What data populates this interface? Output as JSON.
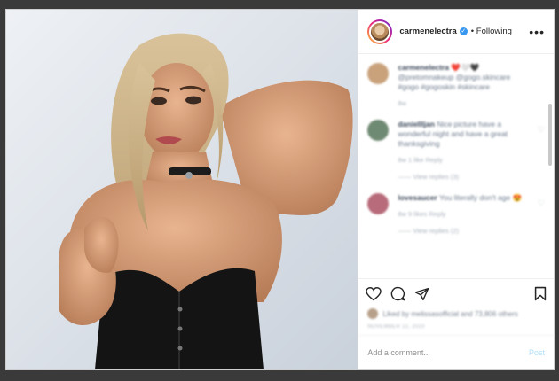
{
  "post": {
    "username": "carmenelectra",
    "follow_state": "• Following",
    "more_label": "•••"
  },
  "comments": [
    {
      "author": "carmenelectra",
      "text": "❤️🤍🖤 @pretomnakeup @gogo.skincare #gogo #gogoskin #skincare",
      "meta": "8w",
      "avatar_color": "#c9a27c"
    },
    {
      "author": "daniellljan",
      "text": "Nice picture have a wonderful night and have a great thanksgiving",
      "meta": "8w   1 like   Reply",
      "replies": "View replies (3)",
      "avatar_color": "#6f8a73"
    },
    {
      "author": "lovesaucer",
      "text": "You literally don't age 😍",
      "meta": "8w   9 likes   Reply",
      "replies": "View replies (2)",
      "avatar_color": "#b86b7a"
    }
  ],
  "likes_text": "Liked by melissasofficial and 73,806 others",
  "date_text": "NOVEMBER 22, 2020",
  "add_comment": {
    "placeholder": "Add a comment...",
    "post_label": "Post"
  },
  "colors": {
    "accent": "#3897f0",
    "post_disabled": "#b2dffc"
  }
}
